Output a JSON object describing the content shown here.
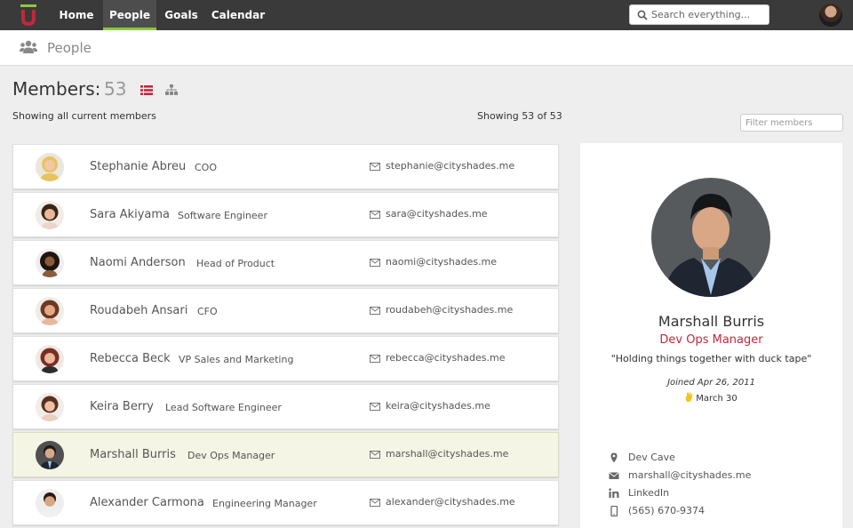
{
  "nav": {
    "items": [
      {
        "label": "Home"
      },
      {
        "label": "People"
      },
      {
        "label": "Goals"
      },
      {
        "label": "Calendar"
      }
    ],
    "search_placeholder": "Search everything...",
    "accent": "#8dc63f"
  },
  "subheader": {
    "title": "People"
  },
  "members": {
    "heading": "Members:",
    "count": "53",
    "showing_left": "Showing all current members",
    "showing_right": "Showing 53 of 53",
    "filter_placeholder": "Filter members",
    "list_icon_color": "#c0283c"
  },
  "people": [
    {
      "name": "Stephanie Abreu",
      "title": "COO",
      "email": "stephanie@cityshades.me"
    },
    {
      "name": "Sara Akiyama",
      "title": "Software Engineer",
      "email": "sara@cityshades.me"
    },
    {
      "name": "Naomi Anderson",
      "title": "Head of Product",
      "email": "naomi@cityshades.me"
    },
    {
      "name": "Roudabeh Ansari",
      "title": "CFO",
      "email": "roudabeh@cityshades.me"
    },
    {
      "name": "Rebecca Beck",
      "title": "VP Sales and Marketing",
      "email": "rebecca@cityshades.me"
    },
    {
      "name": "Keira Berry",
      "title": "Lead Software Engineer",
      "email": "keira@cityshades.me"
    },
    {
      "name": "Marshall Burris",
      "title": "Dev Ops Manager",
      "email": "marshall@cityshades.me"
    },
    {
      "name": "Alexander Carmona",
      "title": "Engineering Manager",
      "email": "alexander@cityshades.me"
    }
  ],
  "profile": {
    "name": "Marshall Burris",
    "role": "Dev Ops Manager",
    "quote": "\"Holding things together with duck tape\"",
    "joined": "Joined Apr 26, 2011",
    "birthday": "March 30",
    "location": "Dev Cave",
    "email": "marshall@cityshades.me",
    "linkedin": "LinkedIn",
    "phone": "(565) 670-9374",
    "role_color": "#c0283c"
  }
}
